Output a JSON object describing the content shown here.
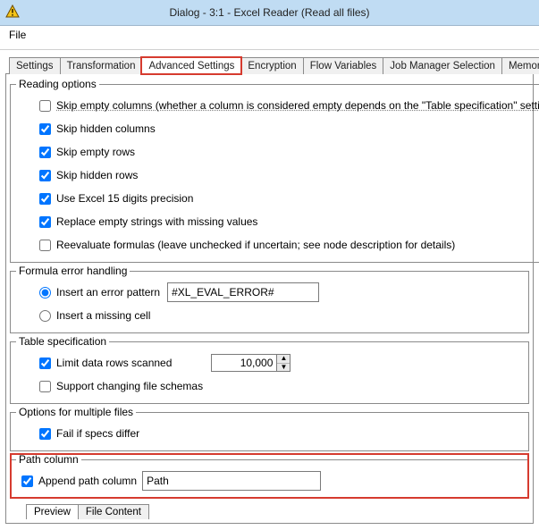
{
  "window": {
    "title": "Dialog - 3:1 - Excel Reader (Read all files)"
  },
  "menu": {
    "file": "File"
  },
  "tabs": {
    "settings": "Settings",
    "transformation": "Transformation",
    "advanced": "Advanced Settings",
    "encryption": "Encryption",
    "flow_variables": "Flow Variables",
    "job_manager": "Job Manager Selection",
    "memory_policy": "Memory Policy"
  },
  "groups": {
    "reading_options": "Reading options",
    "formula_error": "Formula error handling",
    "table_spec": "Table specification",
    "multiple_files": "Options for multiple files",
    "path_column": "Path column"
  },
  "reading": {
    "skip_empty_columns": "Skip empty columns (whether a column is considered empty depends on the \"Table specification\" settings below)",
    "skip_hidden_columns": "Skip hidden columns",
    "skip_empty_rows": "Skip empty rows",
    "skip_hidden_rows": "Skip hidden rows",
    "excel15": "Use Excel 15 digits precision",
    "replace_empty": "Replace empty strings with missing values",
    "reevaluate": "Reevaluate formulas (leave unchecked if uncertain; see node description for details)"
  },
  "formula": {
    "insert_error_pattern": "Insert an error pattern",
    "error_pattern_value": "#XL_EVAL_ERROR#",
    "insert_missing_cell": "Insert a missing cell"
  },
  "table": {
    "limit_rows": "Limit data rows scanned",
    "limit_value": "10,000",
    "support_changing": "Support changing file schemas"
  },
  "multi": {
    "fail_if_differ": "Fail if specs differ"
  },
  "path": {
    "append_label": "Append path column",
    "value": "Path"
  },
  "preview_tabs": {
    "preview": "Preview",
    "file_content": "File Content"
  },
  "icons": {
    "up": "▲",
    "down": "▼"
  }
}
